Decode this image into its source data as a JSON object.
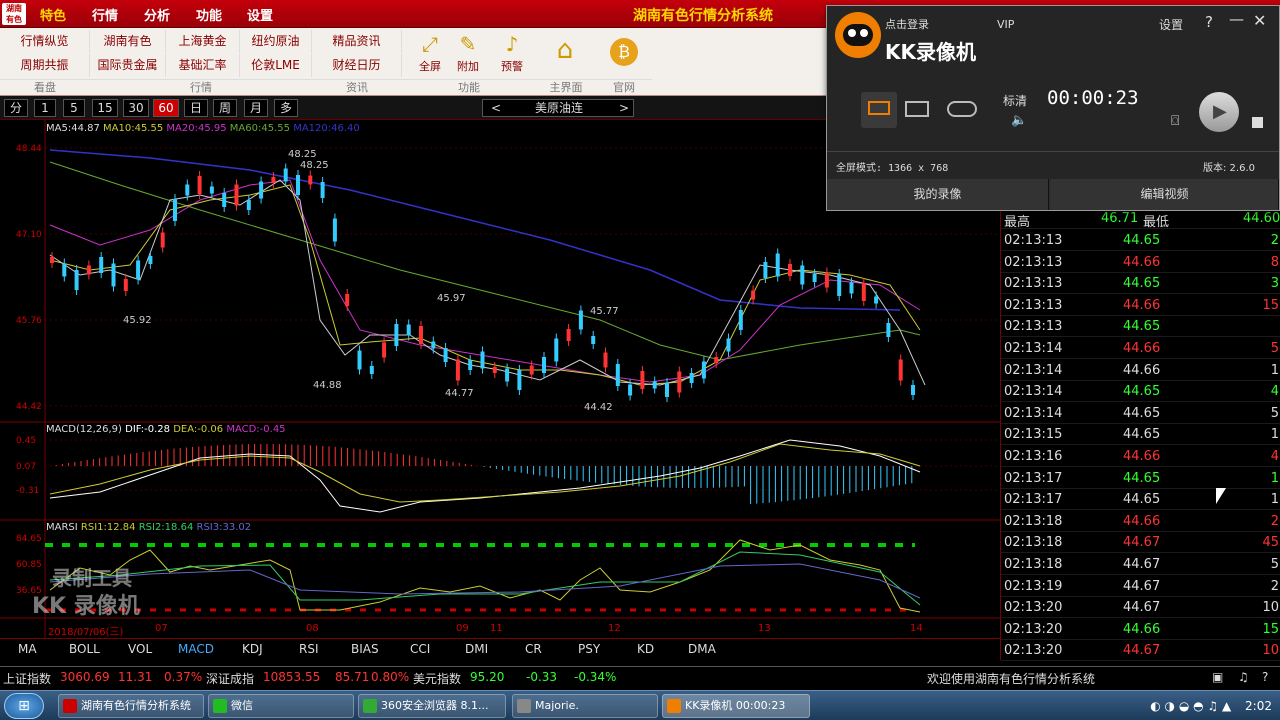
{
  "menubar": {
    "logo": "湖南\n有色",
    "items": [
      "特色",
      "行情",
      "分析",
      "功能",
      "设置"
    ],
    "title": "湖南有色行情分析系统"
  },
  "toolbar": {
    "rows": [
      [
        "行情纵览",
        "湖南有色",
        "上海黄金",
        "纽约原油",
        "精品资讯"
      ],
      [
        "周期共振",
        "国际贵金属",
        "基础汇率",
        "伦敦LME",
        "财经日历"
      ]
    ],
    "captions": [
      "看盘",
      "行情",
      "资讯",
      "功能",
      "主界面",
      "官网"
    ],
    "big": [
      {
        "label": "全屏",
        "icon": "expand-icon"
      },
      {
        "label": "附加",
        "icon": "pin-icon"
      },
      {
        "label": "预警",
        "icon": "bell-icon"
      }
    ],
    "home_icon": "home-icon",
    "web_icon": "coin-icon"
  },
  "periods": [
    "分",
    "1",
    "5",
    "15",
    "30",
    "60",
    "日",
    "周",
    "月",
    "多"
  ],
  "active_period": "60",
  "nav": {
    "prev": "<",
    "name": "美原油连",
    "next": ">"
  },
  "main_indicator": {
    "ma5": "MA5:44.87",
    "ma10": "MA10:45.55",
    "ma20": "MA20:45.95",
    "ma60": "MA60:45.55",
    "ma_extra": "MA120:46.40"
  },
  "price_axis": [
    "48.44",
    "47.10",
    "45.76",
    "44.42"
  ],
  "price_labels": {
    "p1": "48.25",
    "p2": "48.25",
    "p3": "45.92",
    "p4": "45.97",
    "p5": "44.88",
    "p6": "44.77",
    "p7": "45.77",
    "p8": "44.42"
  },
  "macd": {
    "title": "MACD(12,26,9)",
    "dif": "DIF:-0.28",
    "dea": "DEA:-0.06",
    "macd": "MACD:-0.45",
    "axis": [
      "0.45",
      "0.07",
      "-0.31"
    ]
  },
  "rsi": {
    "title": "MARSI",
    "r1": "RSI1:12.84",
    "r2": "RSI2:18.64",
    "r3": "RSI3:33.02",
    "axis": [
      "84.65",
      "60.85",
      "36.65"
    ]
  },
  "xaxis": {
    "date": "2018/07/06(三)",
    "labels": [
      "07",
      "08",
      "09",
      "11",
      "12",
      "13",
      "14"
    ]
  },
  "indicator_tabs": [
    "MA",
    "BOLL",
    "VOL",
    "MACD",
    "KDJ",
    "RSI",
    "BIAS",
    "CCI",
    "DMI",
    "CR",
    "PSY",
    "KD",
    "DMA"
  ],
  "active_indicator": "MACD",
  "quote": {
    "high_label": "最高",
    "high": "46.71",
    "low_label": "最低",
    "low": "44.60"
  },
  "ticks": [
    {
      "t": "02:13:13",
      "p": "44.65",
      "v": "2",
      "c": "#3f3"
    },
    {
      "t": "02:13:13",
      "p": "44.66",
      "v": "8",
      "c": "#f33"
    },
    {
      "t": "02:13:13",
      "p": "44.65",
      "v": "3",
      "c": "#3f3"
    },
    {
      "t": "02:13:13",
      "p": "44.66",
      "v": "15",
      "c": "#f33"
    },
    {
      "t": "02:13:13",
      "p": "44.65",
      "v": "",
      "c": "#3f3"
    },
    {
      "t": "02:13:14",
      "p": "44.66",
      "v": "5",
      "c": "#f33"
    },
    {
      "t": "02:13:14",
      "p": "44.66",
      "v": "1",
      "c": "#ddd"
    },
    {
      "t": "02:13:14",
      "p": "44.65",
      "v": "4",
      "c": "#3f3"
    },
    {
      "t": "02:13:14",
      "p": "44.65",
      "v": "5",
      "c": "#ddd"
    },
    {
      "t": "02:13:15",
      "p": "44.65",
      "v": "1",
      "c": "#ddd"
    },
    {
      "t": "02:13:16",
      "p": "44.66",
      "v": "4",
      "c": "#f33"
    },
    {
      "t": "02:13:17",
      "p": "44.65",
      "v": "1",
      "c": "#3f3"
    },
    {
      "t": "02:13:17",
      "p": "44.65",
      "v": "1",
      "c": "#ddd"
    },
    {
      "t": "02:13:18",
      "p": "44.66",
      "v": "2",
      "c": "#f33"
    },
    {
      "t": "02:13:18",
      "p": "44.67",
      "v": "45",
      "c": "#f33"
    },
    {
      "t": "02:13:18",
      "p": "44.67",
      "v": "5",
      "c": "#ddd"
    },
    {
      "t": "02:13:19",
      "p": "44.67",
      "v": "2",
      "c": "#ddd"
    },
    {
      "t": "02:13:20",
      "p": "44.67",
      "v": "10",
      "c": "#ddd"
    },
    {
      "t": "02:13:20",
      "p": "44.66",
      "v": "15",
      "c": "#3f3"
    },
    {
      "t": "02:13:20",
      "p": "44.67",
      "v": "10",
      "c": "#f33"
    }
  ],
  "status": {
    "sh_label": "上证指数",
    "sh": "3060.69",
    "sh_chg": "11.31",
    "sh_pct": "0.37%",
    "sz_label": "深证成指",
    "sz": "10853.55",
    "sz_chg": "85.71",
    "sz_pct": "0.80%",
    "usd_label": "美元指数",
    "usd": "95.20",
    "usd_chg": "-0.33",
    "usd_pct": "-0.34%",
    "welcome": "欢迎使用湖南有色行情分析系统"
  },
  "taskbar": {
    "tasks": [
      "湖南有色行情分析系统",
      "微信",
      "360安全浏览器 8.1...",
      "Majorie.",
      "KK录像机 00:00:23"
    ],
    "clock": "2:02"
  },
  "kk": {
    "login": "点击登录",
    "vip": "VIP",
    "settings": "设置",
    "help": "?",
    "name": "KK录像机",
    "quality": "标清",
    "timer": "00:00:23",
    "mode": "全屏模式: 1366 x 768",
    "version": "版本: 2.6.0",
    "btn_my": "我的录像",
    "btn_edit": "编辑视频"
  },
  "watermark": {
    "line1": "录制工具",
    "line2": "KK 录像机"
  }
}
